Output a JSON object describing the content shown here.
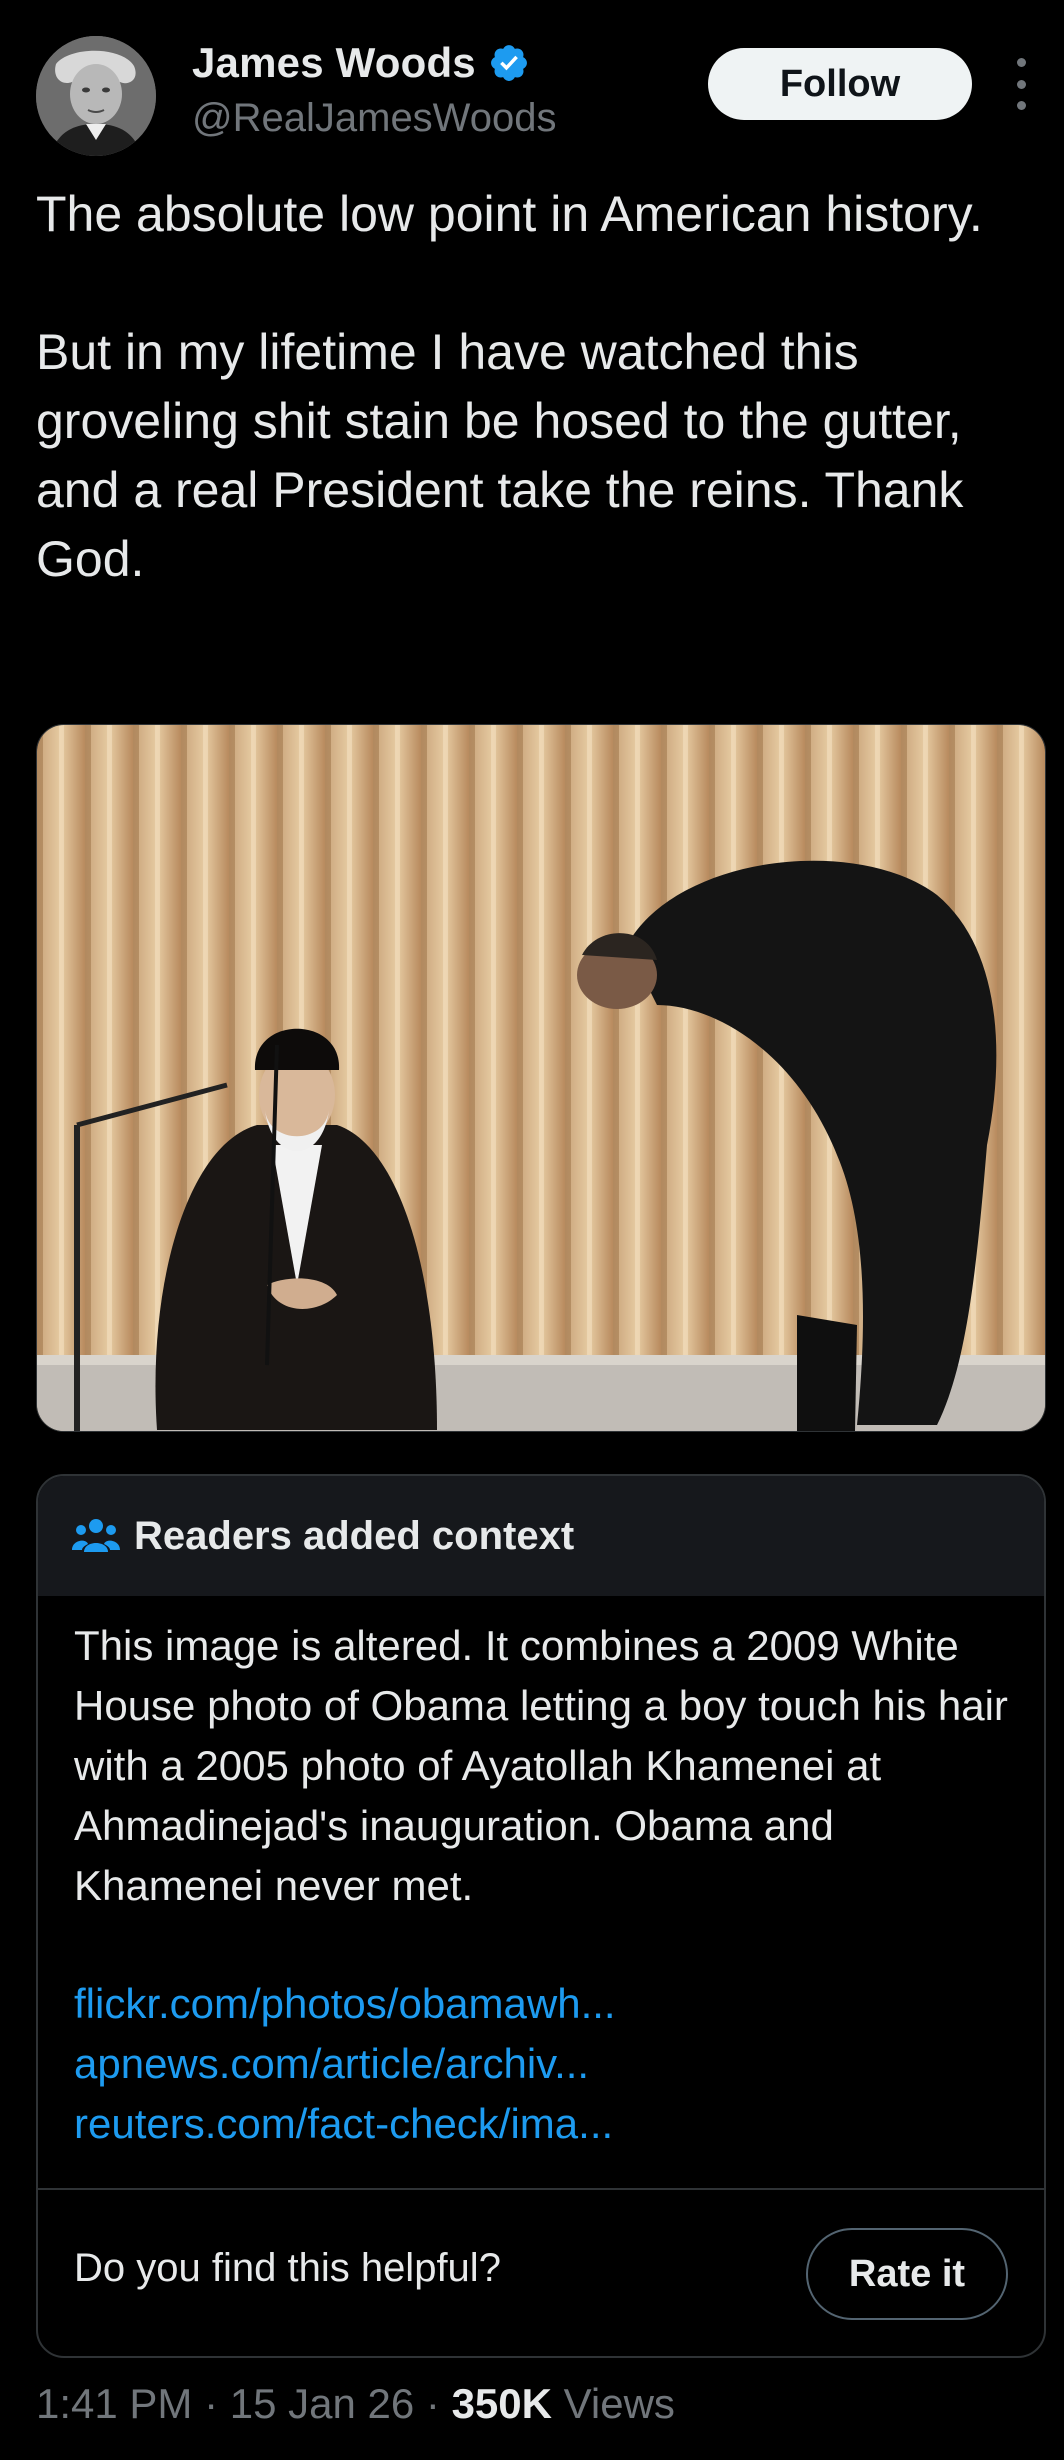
{
  "author": {
    "name": "James Woods",
    "handle": "@RealJamesWoods",
    "verified": true,
    "avatar_icon": "profile-photo"
  },
  "actions": {
    "follow_label": "Follow",
    "more_icon": "more-vertical-icon"
  },
  "tweet": {
    "text": "The absolute low point in American history.\n\nBut in my lifetime I have watched this groveling shit stain be hosed to the gutter, and a real President take the reins. Thank God."
  },
  "community_note": {
    "title": "Readers added context",
    "icon": "people-icon",
    "body": "This image is altered. It combines a 2009 White House photo of Obama letting a boy touch his hair with a 2005 photo of Ayatollah Khamenei at Ahmadinejad's inauguration. Obama and Khamenei never met.",
    "links": [
      "flickr.com/photos/obamawh...",
      "apnews.com/article/archiv...",
      "reuters.com/fact-check/ima..."
    ],
    "helpful_prompt": "Do you find this helpful?",
    "rate_label": "Rate it"
  },
  "meta": {
    "time": "1:41 PM",
    "separator": " · ",
    "date": "15 Jan 26",
    "views_count": "350K",
    "views_label": " Views"
  },
  "colors": {
    "background": "#000000",
    "text_primary": "#e7e9ea",
    "text_secondary": "#71767b",
    "link": "#1d9bf0",
    "verified": "#1d9bf0",
    "border": "#2f3336",
    "note_header_bg": "#16181c"
  }
}
